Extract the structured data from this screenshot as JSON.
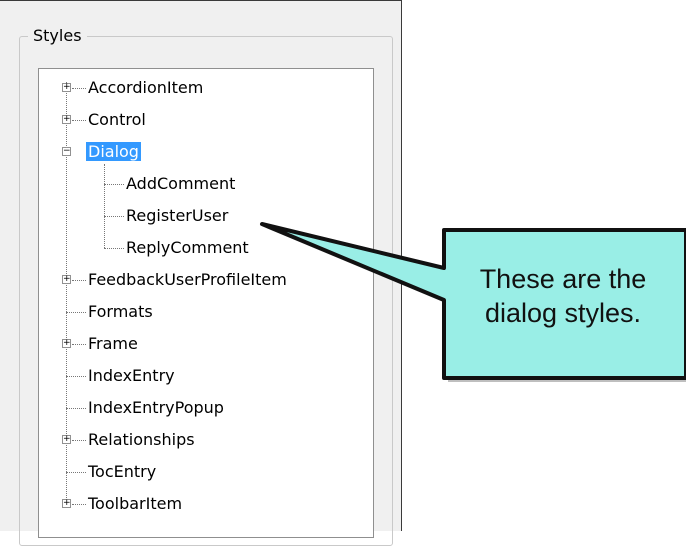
{
  "group": {
    "label": "Styles"
  },
  "tree": {
    "items": [
      {
        "label": "AccordionItem",
        "expander": "+"
      },
      {
        "label": "Control",
        "expander": "+"
      },
      {
        "label": "Dialog",
        "expander": "−",
        "selected": true
      },
      {
        "label": "AddComment"
      },
      {
        "label": "RegisterUser"
      },
      {
        "label": "ReplyComment"
      },
      {
        "label": "FeedbackUserProfileItem",
        "expander": "+"
      },
      {
        "label": "Formats"
      },
      {
        "label": "Frame",
        "expander": "+"
      },
      {
        "label": "IndexEntry"
      },
      {
        "label": "IndexEntryPopup"
      },
      {
        "label": "Relationships",
        "expander": "+"
      },
      {
        "label": "TocEntry"
      },
      {
        "label": "ToolbarItem",
        "expander": "+"
      }
    ]
  },
  "callout": {
    "line1": "These are the",
    "line2": "dialog styles.",
    "fill_color": "#99eee6"
  }
}
